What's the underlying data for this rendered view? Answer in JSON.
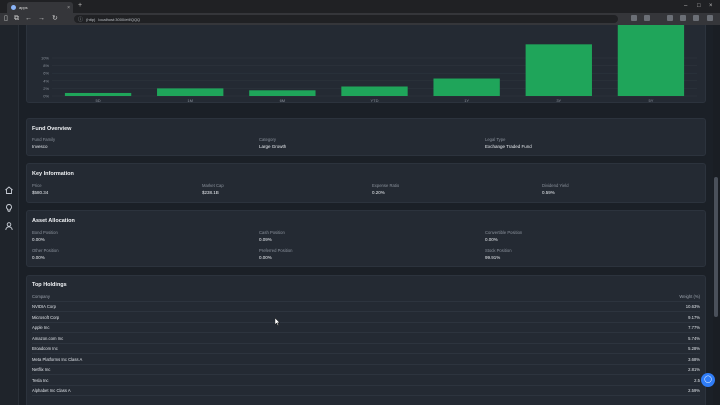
{
  "browser": {
    "tab_title": "apps",
    "url": "localhost:3000/etf/QQQ",
    "url_prefix": "(http)",
    "new_tab": "+",
    "tab_close": "×"
  },
  "chart_data": {
    "type": "bar",
    "categories": [
      "5D",
      "1M",
      "6M",
      "YTD",
      "1Y",
      "3Y",
      "5Y"
    ],
    "values": [
      0.8,
      2.0,
      1.5,
      2.5,
      4.6,
      13.6,
      19.6
    ],
    "ylim": [
      0,
      20
    ],
    "yticks": [
      "0%",
      "2%",
      "4%",
      "6%",
      "8%",
      "10%"
    ],
    "bar_color": "#1fa55a",
    "grid": true
  },
  "fund_overview": {
    "title": "Fund Overview",
    "fields": [
      {
        "label": "Fund Family",
        "value": "Invesco"
      },
      {
        "label": "Category",
        "value": "Large Growth"
      },
      {
        "label": "Legal Type",
        "value": "Exchange Traded Fund"
      }
    ]
  },
  "key_information": {
    "title": "Key Information",
    "fields": [
      {
        "label": "Price",
        "value": "$580.34"
      },
      {
        "label": "Market Cap",
        "value": "$238.1B"
      },
      {
        "label": "Expense Ratio",
        "value": "0.20%"
      },
      {
        "label": "Dividend Yield",
        "value": "0.59%"
      }
    ]
  },
  "asset_allocation": {
    "title": "Asset Allocation",
    "fields": [
      {
        "label": "Bond Position",
        "value": "0.00%"
      },
      {
        "label": "Cash Position",
        "value": "0.09%"
      },
      {
        "label": "Convertible Position",
        "value": "0.00%"
      },
      {
        "label": "Other Position",
        "value": "0.00%"
      },
      {
        "label": "Preferred Position",
        "value": "0.00%"
      },
      {
        "label": "Stock Position",
        "value": "99.91%"
      }
    ]
  },
  "top_holdings": {
    "title": "Top Holdings",
    "col_company": "Company",
    "col_weight": "Weight (%)",
    "rows": [
      {
        "company": "NVIDIA Corp",
        "weight": "10.63%"
      },
      {
        "company": "Microsoft Corp",
        "weight": "9.17%"
      },
      {
        "company": "Apple Inc",
        "weight": "7.77%"
      },
      {
        "company": "Amazon.com Inc",
        "weight": "5.74%"
      },
      {
        "company": "Broadcom Inc",
        "weight": "5.28%"
      },
      {
        "company": "Meta Platforms Inc Class A",
        "weight": "3.68%"
      },
      {
        "company": "Netflix Inc",
        "weight": "2.81%"
      },
      {
        "company": "Tesla Inc",
        "weight": "2.5"
      },
      {
        "company": "Alphabet Inc Class A",
        "weight": "2.59%"
      }
    ]
  },
  "colors": {
    "accent": "#1fa55a",
    "chat": "#2f7cf6"
  }
}
